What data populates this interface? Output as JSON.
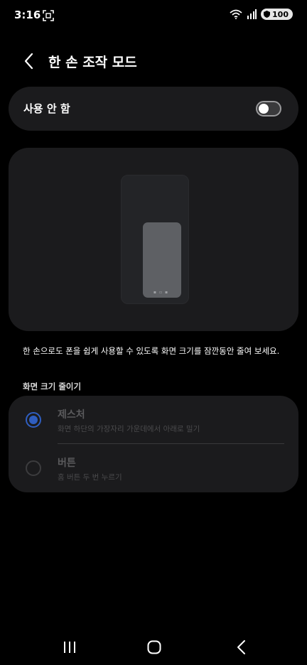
{
  "status_bar": {
    "time": "3:16",
    "battery": "100"
  },
  "header": {
    "title": "한 손 조작 모드"
  },
  "master_toggle": {
    "label": "사용 안 함",
    "enabled": false
  },
  "description": "한 손으로도 폰을 쉽게 사용할 수 있도록 화면 크기를 잠깐동안 줄여 보세요.",
  "section": {
    "label": "화면 크기 줄이기"
  },
  "options": [
    {
      "title": "제스처",
      "subtitle": "화면 하단의 가장자리 가운데에서 아래로 밀기",
      "selected": true
    },
    {
      "title": "버튼",
      "subtitle": "홈 버튼 두 번 누르기",
      "selected": false
    }
  ],
  "colors": {
    "background": "#000000",
    "card": "#1b1b1d",
    "accent": "#2f5ec0"
  },
  "icons": {
    "screenshot": "screenshot-icon",
    "wifi": "wifi-icon",
    "signal": "signal-icon",
    "battery": "battery-icon",
    "back": "chevron-left-icon",
    "nav_recents": "recents-icon",
    "nav_home": "home-icon",
    "nav_back": "back-icon"
  }
}
